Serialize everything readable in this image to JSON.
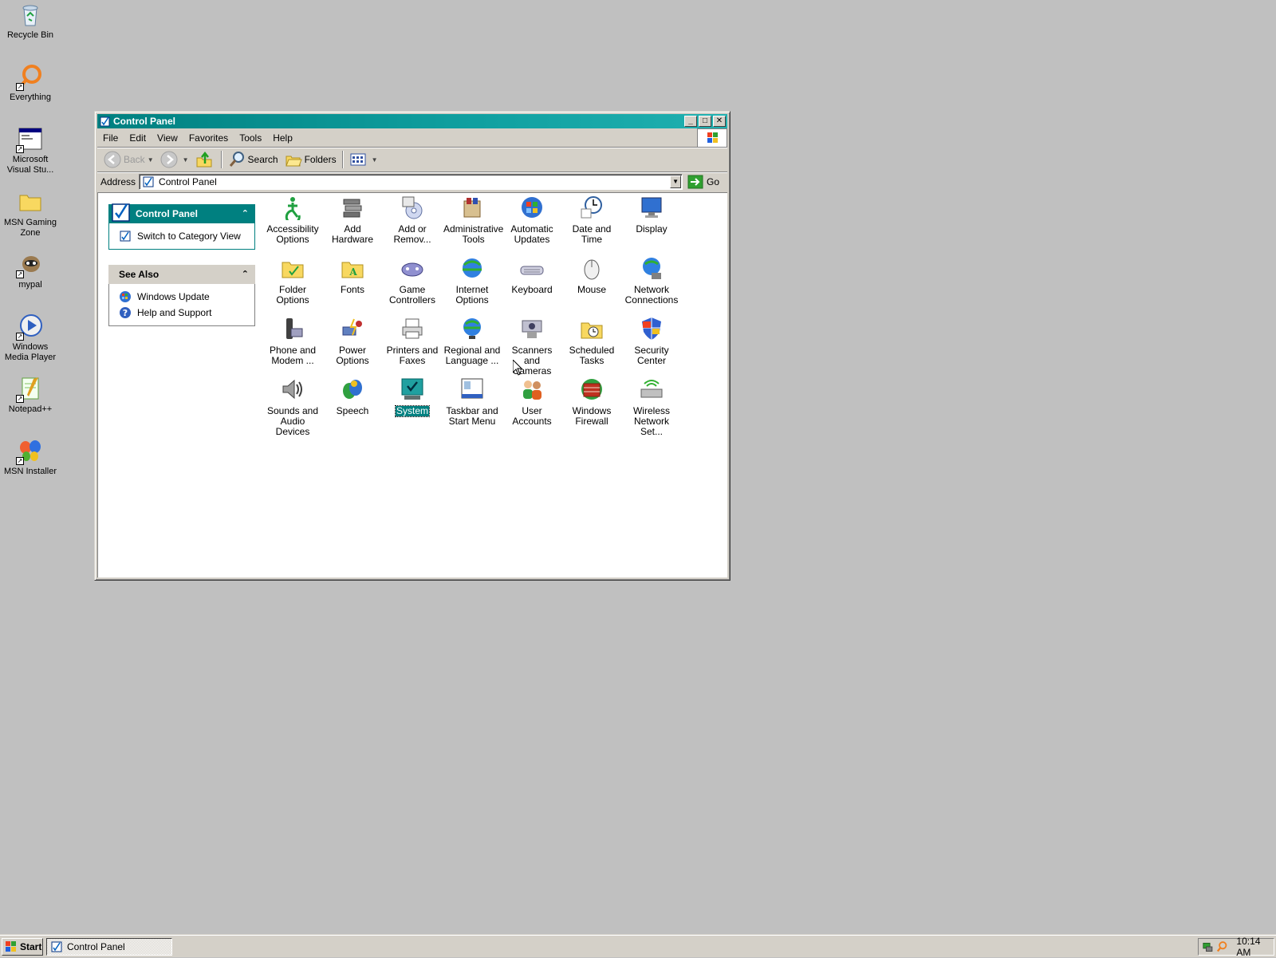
{
  "desktop": {
    "icons": [
      {
        "label": "Recycle Bin",
        "icon": "recycle-bin-icon"
      },
      {
        "label": "Everything",
        "icon": "everything-search-icon"
      },
      {
        "label": "Microsoft\nVisual Stu...",
        "icon": "visual-studio-icon"
      },
      {
        "label": "MSN Gaming\nZone",
        "icon": "folder-icon"
      },
      {
        "label": "mypal",
        "icon": "mypal-icon"
      },
      {
        "label": "Windows\nMedia Player",
        "icon": "media-player-icon"
      },
      {
        "label": "Notepad++",
        "icon": "notepad-plus-icon"
      },
      {
        "label": "MSN Installer",
        "icon": "msn-butterfly-icon"
      }
    ]
  },
  "window": {
    "title": "Control Panel",
    "menu": [
      "File",
      "Edit",
      "View",
      "Favorites",
      "Tools",
      "Help"
    ],
    "toolbar": {
      "back": "Back",
      "search": "Search",
      "folders": "Folders"
    },
    "address": {
      "label": "Address",
      "value": "Control Panel",
      "go": "Go"
    },
    "side_panels": [
      {
        "title": "Control Panel",
        "links": [
          "Switch to Category View"
        ]
      },
      {
        "title": "See Also",
        "links": [
          "Windows Update",
          "Help and Support"
        ]
      }
    ],
    "items": [
      "Accessibility\nOptions",
      "Add Hardware",
      "Add or\nRemov...",
      "Administrative\nTools",
      "Automatic\nUpdates",
      "Date and Time",
      "Display",
      "Folder Options",
      "Fonts",
      "Game\nControllers",
      "Internet\nOptions",
      "Keyboard",
      "Mouse",
      "Network\nConnections",
      "Phone and\nModem ...",
      "Power Options",
      "Printers and\nFaxes",
      "Regional and\nLanguage ...",
      "Scanners and\nCameras",
      "Scheduled\nTasks",
      "Security\nCenter",
      "Sounds and\nAudio Devices",
      "Speech",
      "System",
      "Taskbar and\nStart Menu",
      "User Accounts",
      "Windows\nFirewall",
      "Wireless\nNetwork Set..."
    ],
    "selected_item": "System"
  },
  "taskbar": {
    "start": "Start",
    "task": "Control Panel",
    "clock": "10:14 AM"
  },
  "colors": {
    "titlebar": "#008080",
    "desktop": "#c0c0c0",
    "selection": "#008080"
  }
}
